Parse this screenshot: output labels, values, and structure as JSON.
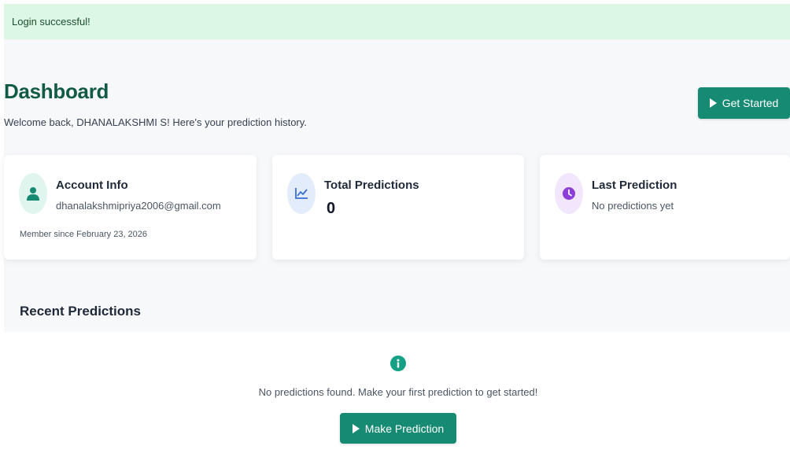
{
  "alert": {
    "message": "Login successful!"
  },
  "header": {
    "title": "Dashboard",
    "subtitle": "Welcome back, DHANALAKSHMI S! Here's your prediction history.",
    "get_started_label": "Get Started"
  },
  "cards": {
    "account": {
      "title": "Account Info",
      "email": "dhanalakshmipriya2006@gmail.com",
      "member_since": "Member since February 23, 2026",
      "icon": "user-icon"
    },
    "total": {
      "title": "Total Predictions",
      "value": "0",
      "icon": "chart-line-icon"
    },
    "last": {
      "title": "Last Prediction",
      "text": "No predictions yet",
      "icon": "clock-icon"
    }
  },
  "recent": {
    "title": "Recent Predictions",
    "empty_message": "No predictions found. Make your first prediction to get started!",
    "make_prediction_label": "Make Prediction"
  },
  "colors": {
    "brand": "#178a73",
    "title": "#115a45",
    "alert_bg": "#dcf7e4",
    "info_icon": "#16a085",
    "user_icon": "#178a73",
    "chart_icon": "#3b6fd1",
    "clock_icon": "#8b3fd6"
  }
}
